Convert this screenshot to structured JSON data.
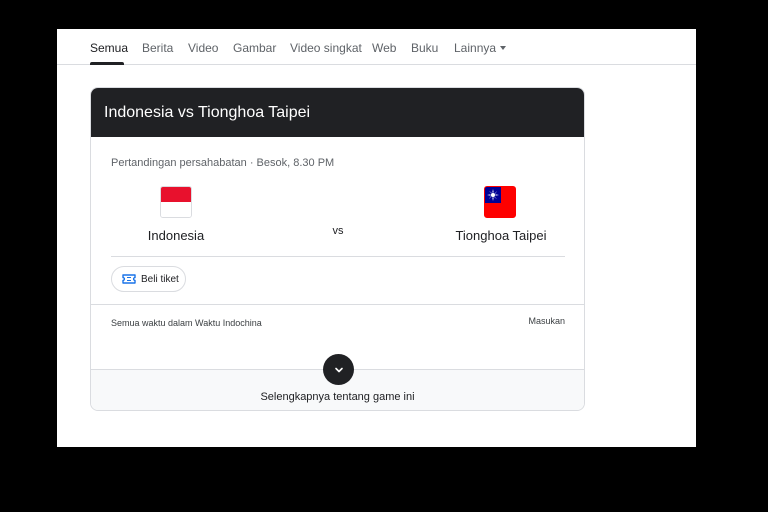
{
  "tabs": [
    {
      "label": "Semua",
      "active": true
    },
    {
      "label": "Berita"
    },
    {
      "label": "Video"
    },
    {
      "label": "Gambar"
    },
    {
      "label": "Video singkat"
    },
    {
      "label": "Web"
    },
    {
      "label": "Buku"
    },
    {
      "label": "Lainnya"
    }
  ],
  "match": {
    "title": "Indonesia vs Tionghoa Taipei",
    "info": "Pertandingan persahabatan · Besok, 8.30 PM",
    "vs_label": "vs",
    "home": {
      "name": "Indonesia",
      "flag_icon": "indonesia-flag-icon",
      "flag_colors": [
        "#e8112d",
        "#ffffff"
      ]
    },
    "away": {
      "name": "Tionghoa Taipei",
      "flag_icon": "taiwan-flag-icon",
      "flag_colors": [
        "#fe0000",
        "#000095",
        "#ffffff"
      ]
    }
  },
  "ticket_button": {
    "label": "Beli tiket",
    "icon": "ticket-icon",
    "color": "#1a73e8"
  },
  "footer": {
    "timezone_note": "Semua waktu dalam Waktu Indochina",
    "login_link": "Masukan"
  },
  "more": {
    "label": "Selengkapnya tentang game ini",
    "icon": "chevron-down-icon"
  },
  "colors": {
    "header_bg": "#202124",
    "accent": "#1a73e8"
  }
}
